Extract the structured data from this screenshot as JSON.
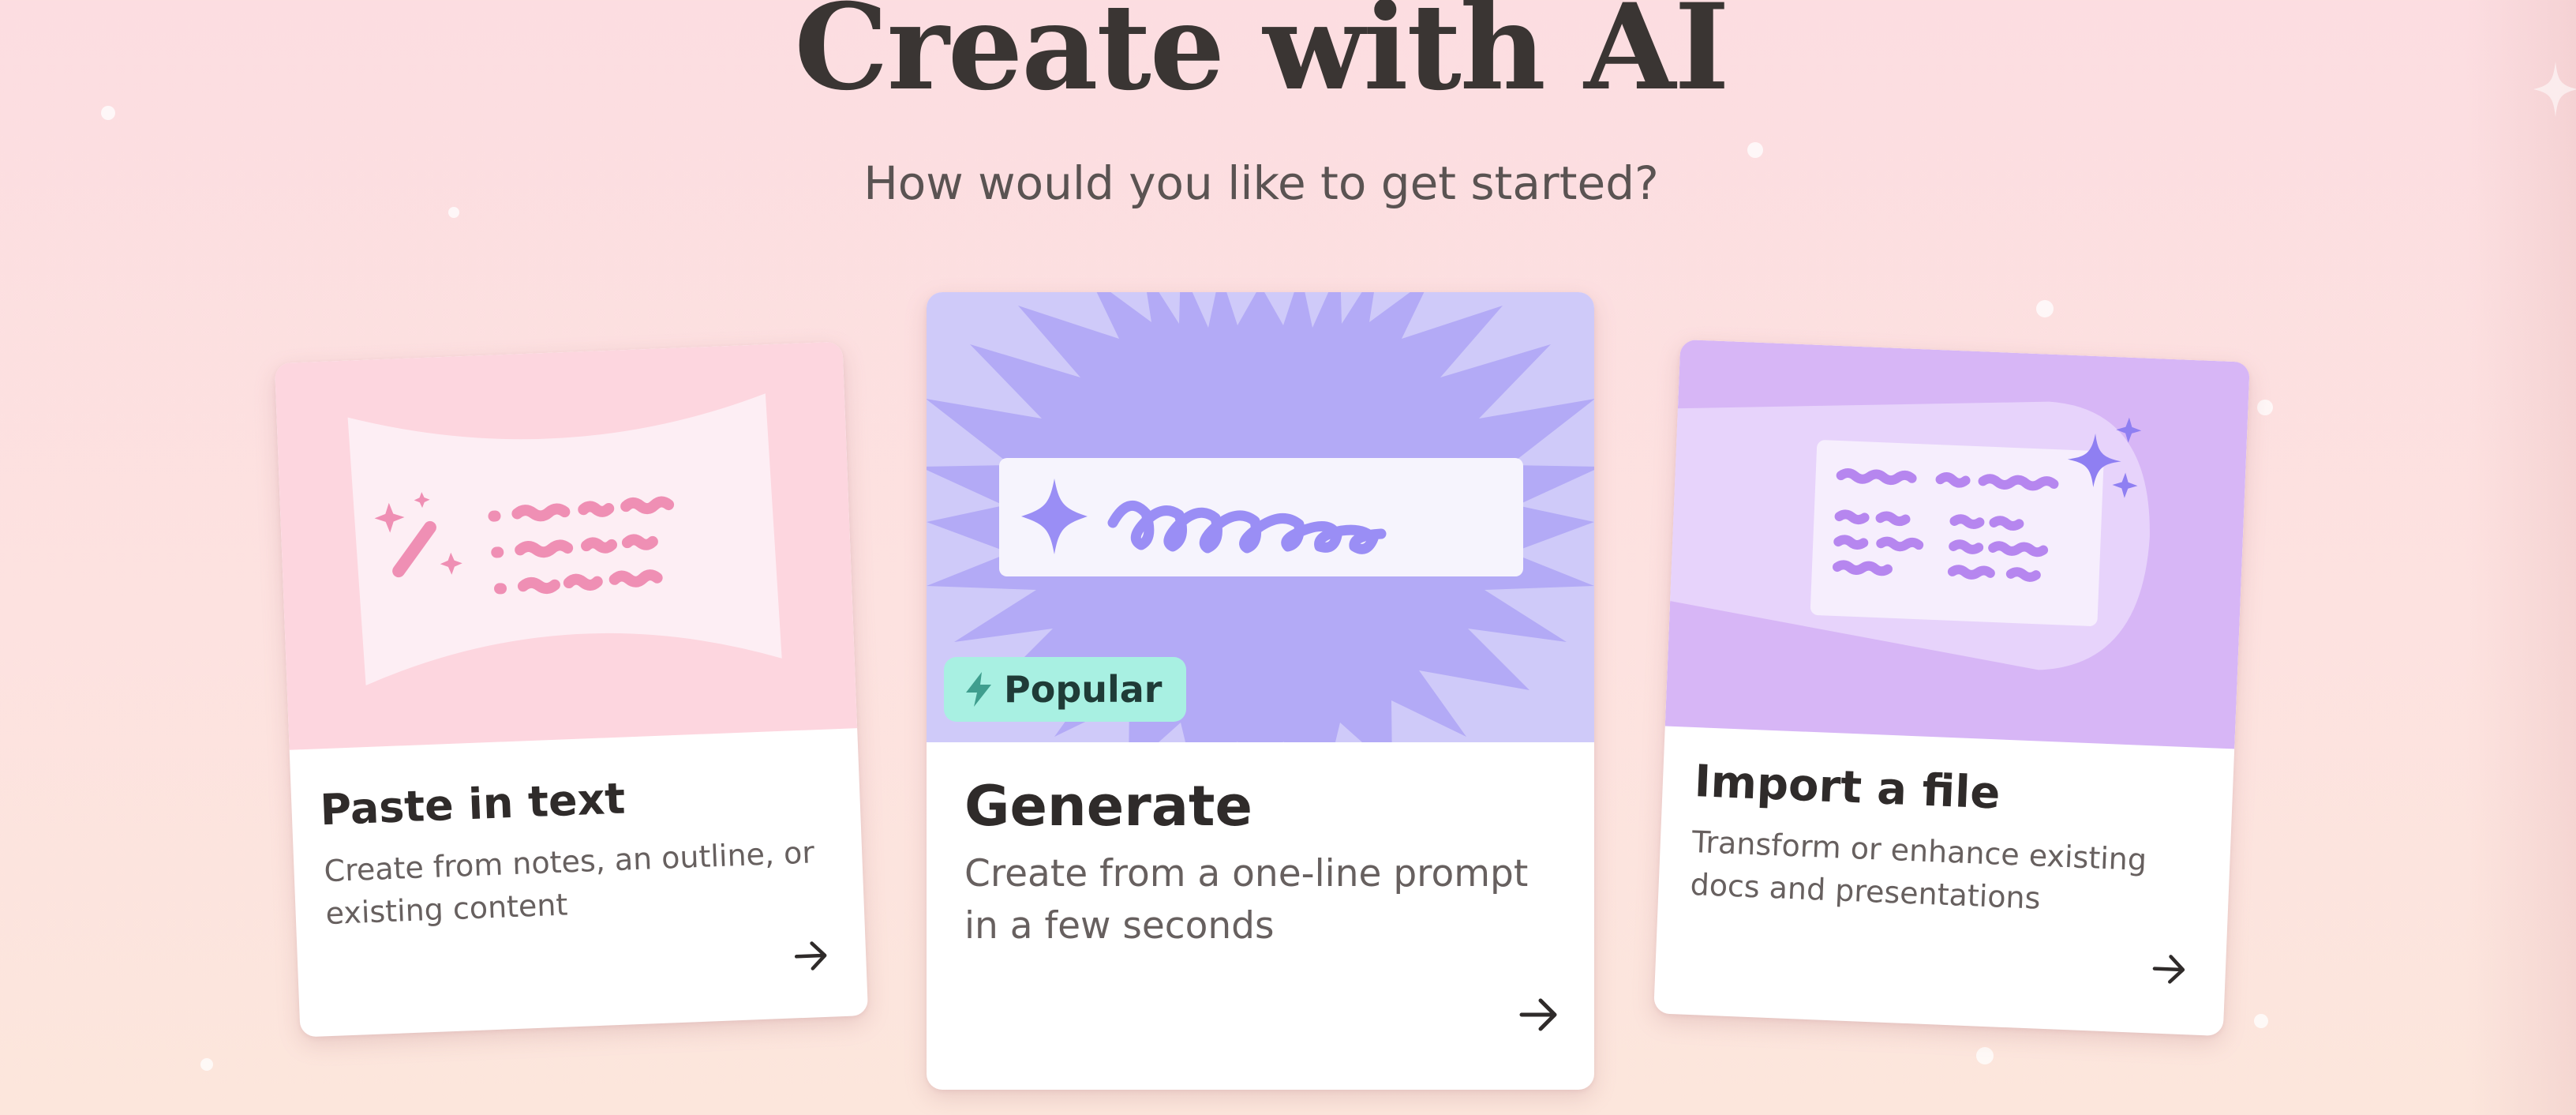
{
  "header": {
    "title": "Create with AI",
    "subtitle": "How would you like to get started?"
  },
  "cards": [
    {
      "title": "Paste in text",
      "description": "Create from notes, an outline, or existing content",
      "icon": "magic-wand-icon",
      "arrow_icon": "arrow-right-icon"
    },
    {
      "title": "Generate",
      "description": "Create from a one-line prompt in a few seconds",
      "badge": "Popular",
      "badge_icon": "lightning-bolt-icon",
      "icon": "sparkle-icon",
      "arrow_icon": "arrow-right-icon"
    },
    {
      "title": "Import a file",
      "description": "Transform or enhance existing docs and presentations",
      "icon": "sparkles-icon",
      "arrow_icon": "arrow-right-icon"
    }
  ],
  "colors": {
    "background_top": "#fcdde1",
    "background_bottom": "#fce6dc",
    "paste_art": "#fdd6df",
    "generate_art": "#cfcaf9",
    "import_art": "#d7b6f6",
    "badge": "#a8f0e2",
    "title_text": "#3a3533"
  }
}
